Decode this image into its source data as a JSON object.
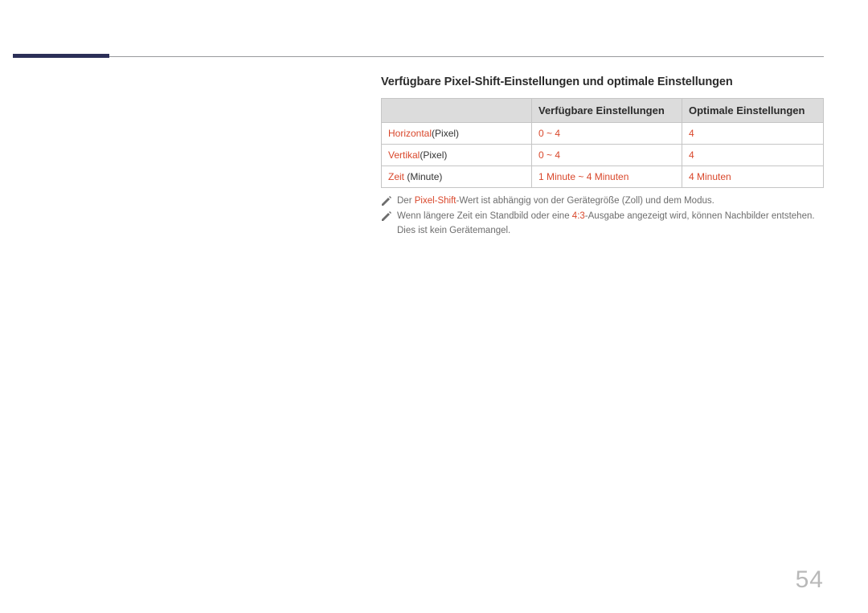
{
  "page_number": "54",
  "section_title": "Verfügbare Pixel-Shift-Einstellungen und optimale Einstellungen",
  "table": {
    "headers": {
      "available": "Verfügbare Einstellungen",
      "optimal": "Optimale Einstellungen"
    },
    "rows": [
      {
        "label_hl": "Horizontal",
        "label_rest": "(Pixel)",
        "available": "0 ~ 4",
        "optimal": "4",
        "row_hl": true
      },
      {
        "label_hl": "Vertikal",
        "label_rest": "(Pixel)",
        "available": "0 ~ 4",
        "optimal": "4",
        "row_hl": true
      },
      {
        "label_hl": "Zeit",
        "label_rest": " (Minute)",
        "available": "1 Minute ~ 4 Minuten",
        "optimal": "4 Minuten",
        "row_hl": true
      }
    ]
  },
  "notes": {
    "n1": {
      "pre": "Der ",
      "hl": "Pixel-Shift",
      "post": "-Wert ist abhängig von der Gerätegröße (Zoll) und dem Modus."
    },
    "n2": {
      "pre": "Wenn längere Zeit ein Standbild oder eine ",
      "hl": "4:3",
      "post": "-Ausgabe angezeigt wird, können Nachbilder entstehen. Dies ist kein Gerätemangel."
    }
  }
}
